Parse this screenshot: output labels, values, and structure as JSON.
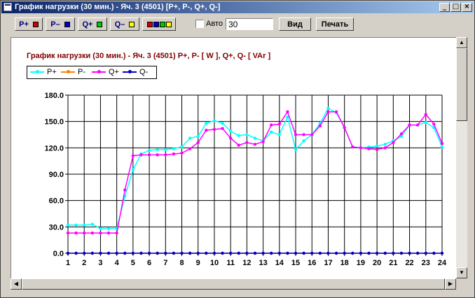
{
  "window": {
    "title": "График нагрузки (30 мин.) - Яч. 3 (4501)   [P+, P-, Q+, Q-]",
    "min_glyph": "_",
    "max_glyph": "□",
    "close_glyph": "×"
  },
  "toolbar": {
    "buttons": [
      {
        "label": "P+",
        "swatch": "#cc0000"
      },
      {
        "label": "P–",
        "swatch": "#0000cc"
      },
      {
        "label": "Q+",
        "swatch": "#00cc00"
      },
      {
        "label": "Q–",
        "swatch": "#ffff00"
      }
    ],
    "all_swatches": [
      "#cc0000",
      "#0000cc",
      "#00cc00",
      "#ffff00"
    ],
    "auto_label": "Авто",
    "auto_checked": false,
    "interval_value": "30",
    "view_label": "Вид",
    "print_label": "Печать"
  },
  "chart_title": "График нагрузки (30 мин.) - Яч. 3 (4501)    P+, P- [ W ],  Q+, Q- [ VAr ]",
  "chart_data": {
    "type": "line",
    "x": [
      1,
      1.5,
      2,
      2.5,
      3,
      3.5,
      4,
      4.5,
      5,
      5.5,
      6,
      6.5,
      7,
      7.5,
      8,
      8.5,
      9,
      9.5,
      10,
      10.5,
      11,
      11.5,
      12,
      12.5,
      13,
      13.5,
      14,
      14.5,
      15,
      15.5,
      16,
      16.5,
      17,
      17.5,
      18,
      18.5,
      19,
      19.5,
      20,
      20.5,
      21,
      21.5,
      22,
      22.5,
      23,
      23.5,
      24
    ],
    "xticks": [
      1,
      2,
      3,
      4,
      5,
      6,
      7,
      8,
      9,
      10,
      11,
      12,
      13,
      14,
      15,
      16,
      17,
      18,
      19,
      20,
      21,
      22,
      23,
      24
    ],
    "yticks": [
      "0.0",
      "30.0",
      "60.0",
      "90.0",
      "120.0",
      "150.0",
      "180.0"
    ],
    "ylim": [
      0,
      180
    ],
    "grid": true,
    "legend_position": "top-left",
    "series": [
      {
        "name": "P+",
        "color": "#00ffff",
        "values": [
          32,
          32,
          32,
          33,
          28,
          28,
          28,
          65,
          95,
          113,
          117,
          118,
          118,
          119,
          121,
          131,
          133,
          148,
          151,
          148,
          139,
          134,
          135,
          131,
          128,
          138,
          135,
          155,
          118,
          128,
          135,
          148,
          165,
          160,
          143,
          121,
          120,
          121,
          122,
          124,
          128,
          133,
          146,
          146,
          149,
          143,
          121
        ]
      },
      {
        "name": "P-",
        "color": "#ff8000",
        "values": [
          0,
          0,
          0,
          0,
          0,
          0,
          0,
          0,
          0,
          0,
          0,
          0,
          0,
          0,
          0,
          0,
          0,
          0,
          0,
          0,
          0,
          0,
          0,
          0,
          0,
          0,
          0,
          0,
          0,
          0,
          0,
          0,
          0,
          0,
          0,
          0,
          0,
          0,
          0,
          0,
          0,
          0,
          0,
          0,
          0,
          0,
          0
        ]
      },
      {
        "name": "Q+",
        "color": "#ff00ff",
        "values": [
          23,
          23,
          23,
          23,
          23,
          23,
          23,
          72,
          111,
          112,
          112,
          112,
          112,
          113,
          114,
          119,
          126,
          140,
          141,
          142,
          131,
          123,
          126,
          124,
          127,
          146,
          147,
          161,
          135,
          135,
          135,
          145,
          161,
          161,
          143,
          121,
          120,
          119,
          118,
          120,
          126,
          136,
          146,
          146,
          158,
          147,
          125
        ]
      },
      {
        "name": "Q-",
        "color": "#0000c0",
        "values": [
          0,
          0,
          0,
          0,
          0,
          0,
          0,
          0,
          0,
          0,
          0,
          0,
          0,
          0,
          0,
          0,
          0,
          0,
          0,
          0,
          0,
          0,
          0,
          0,
          0,
          0,
          0,
          0,
          0,
          0,
          0,
          0,
          0,
          0,
          0,
          0,
          0,
          0,
          0,
          0,
          0,
          0,
          0,
          0,
          0,
          0,
          0
        ]
      }
    ]
  }
}
